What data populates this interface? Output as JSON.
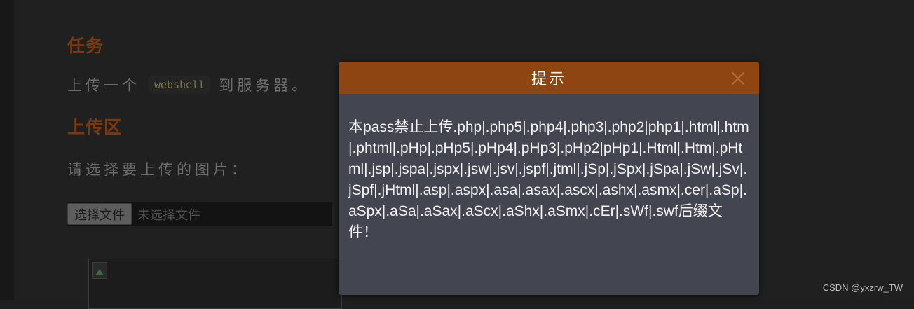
{
  "page": {
    "task_title": "任务",
    "task_text_before": "上传一个",
    "task_code": "webshell",
    "task_text_after": "到服务器。",
    "upload_title": "上传区",
    "choose_prompt": "请选择要上传的图片：",
    "file_button": "选择文件",
    "file_status": "未选择文件"
  },
  "dialog": {
    "title": "提示",
    "message": "本pass禁止上传.php|.php5|.php4|.php3|.php2|php1|.html|.htm|.phtml|.pHp|.pHp5|.pHp4|.pHp3|.pHp2|pHp1|.Html|.Htm|.pHtml|.jsp|.jspa|.jspx|.jsw|.jsv|.jspf|.jtml|.jSp|.jSpx|.jSpa|.jSw|.jSv|.jSpf|.jHtml|.asp|.aspx|.asa|.asax|.ascx|.ashx|.asmx|.cer|.aSp|.aSpx|.aSa|.aSax|.aScx|.aShx|.aSmx|.cEr|.sWf|.swf后缀文件！"
  },
  "watermark": "CSDN @yxzrw_TW",
  "icons": {
    "close": "close-icon",
    "broken_image": "broken-image-icon"
  },
  "colors": {
    "accent": "#8f4511",
    "dialog_body": "#434650",
    "background": "#202020"
  }
}
